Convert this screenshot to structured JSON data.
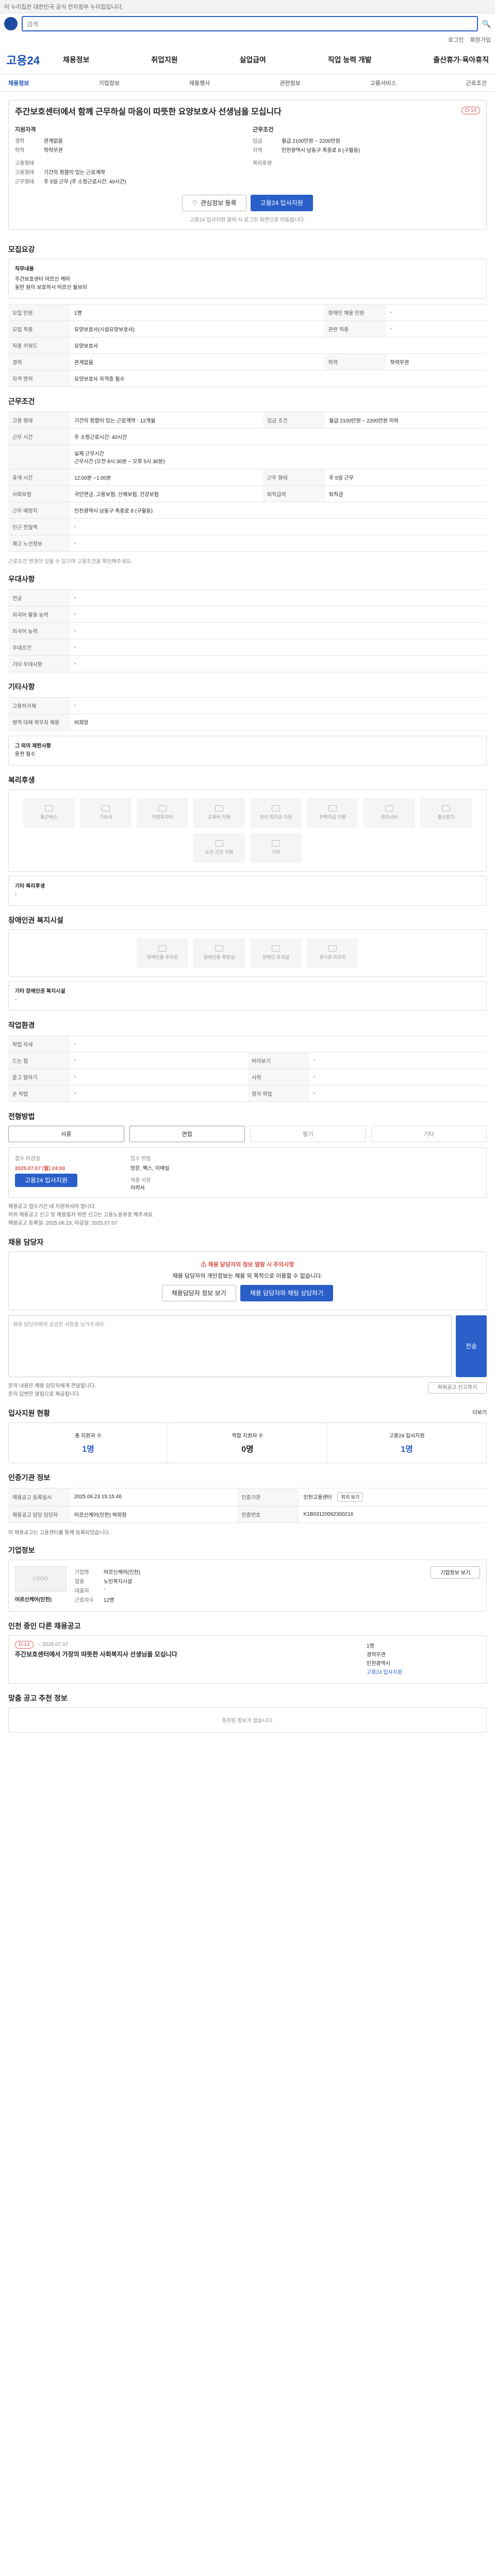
{
  "top_notice": "이 누리집은 대한민국 공식 전자정부 누리집입니다.",
  "search_placeholder": "검색",
  "util_links": [
    "로그인",
    "회원가입"
  ],
  "brand": "고용24",
  "gnb": [
    "채용정보",
    "취업지원",
    "실업급여",
    "직업 능력 개발",
    "출산휴가·육아휴직"
  ],
  "subnav": {
    "active": "채용정보",
    "items": [
      "채용정보",
      "기업정보",
      "채용행사",
      "관련정보",
      "고용서비스",
      "근로조건"
    ]
  },
  "job": {
    "title": "주간보호센터에서 함께 근무하실 마음이 따뜻한 요양보호사 선생님을 모십니다",
    "dday": "D-14",
    "left_head": "지원자격",
    "left_rows": [
      {
        "k": "경력",
        "v": "관계없음"
      },
      {
        "k": "학력",
        "v": "학력무관"
      },
      {
        "k": "고용형태",
        "v": ""
      },
      {
        "k": "고용형태",
        "v": "기간의 정함이 있는 근로계약"
      },
      {
        "k": "근무형태",
        "v": "주 5일 근무 (주 소정근로시간: 40시간)"
      }
    ],
    "right_head": "근무조건",
    "right_rows": [
      {
        "k": "임금",
        "v": "월급 2100만원 ~ 2200만원"
      },
      {
        "k": "지역",
        "v": "인천광역시 남동구 족중로 8 (구월동)"
      },
      {
        "k": "복리후생",
        "v": ""
      }
    ],
    "btn_scrap": "관심정보 등록",
    "btn_apply": "고용24 입사지원",
    "note": "고용24 입사지원 클릭 시 로그인 화면으로 이동됩니다."
  },
  "recruit": {
    "title": "모집요강",
    "desc_label": "직무내용",
    "desc": "주간보호센터 어르신 케어\n동반 원이 보호하시 어르신 돌보미",
    "rows": [
      {
        "k": "모집 인원",
        "v": "1명",
        "k2": "장애인 채용 인원",
        "v2": "-"
      },
      {
        "k": "모집 직종",
        "v": "요양보호사(시설요양보호사)",
        "k2": "관련 직종",
        "v2": "-"
      },
      {
        "k": "직종 키워드",
        "v": "요양보호사",
        "k2": "",
        "v2": ""
      },
      {
        "k": "경력",
        "v": "관계없음",
        "k2": "학력",
        "v2": "학력무관"
      },
      {
        "k": "자격 면허",
        "v": "요양보호사 자격증 필수",
        "k2": "",
        "v2": ""
      }
    ]
  },
  "conditions": {
    "title": "근무조건",
    "rows": [
      {
        "k": "고용 형태",
        "v": "기간의 정함이 있는 근로계약 · 12개월",
        "k2": "임금 조건",
        "v2": "월급 2100만원 ~ 2200만원 이하"
      },
      {
        "k": "근무 시간",
        "v": "주 소정근로시간: 40시간",
        "k2": "",
        "v2": ""
      },
      {
        "k": "",
        "v": "실제 근무시간\n근무시간 (오전 8시 30분 ~ 오후 5시 30분)",
        "k2": "",
        "v2": ""
      },
      {
        "k": "휴게 시간",
        "v": "12:00분 ~1:00분",
        "k2": "근무 형태",
        "v2": "주 5일 근무"
      },
      {
        "k": "사회보험",
        "v": "국민연금, 고용보험, 산재보험, 건강보험",
        "k2": "퇴직급여",
        "v2": "퇴직금"
      },
      {
        "k": "근무 예정지",
        "v": "인천광역시 남동구 족중로 8 (구월동)",
        "k2": "",
        "v2": ""
      },
      {
        "k": "인근 전철역",
        "v": "-",
        "k2": "",
        "v2": ""
      },
      {
        "k": "재고 노선정보",
        "v": "-",
        "k2": "",
        "v2": ""
      }
    ],
    "note": "근로조건 변경이 있을 수 있으며 고용조건을 확인해주세요."
  },
  "preference": {
    "title": "우대사항",
    "rows": [
      {
        "k": "전공",
        "v": "-"
      },
      {
        "k": "외국어 활용 능력",
        "v": "-"
      },
      {
        "k": "외국어 능력",
        "v": "-"
      },
      {
        "k": "우대조건",
        "v": "-"
      },
      {
        "k": "기타 우대사항",
        "v": "-"
      }
    ]
  },
  "etc": {
    "title": "기타사항",
    "rows": [
      {
        "k": "고용허가제",
        "v": "-"
      },
      {
        "k": "병역 대체 복무자 채용",
        "v": "비희망"
      }
    ],
    "extra_label": "그 외의 제한사항",
    "extra_value": "운전 필수"
  },
  "welfare": {
    "title": "복리후생",
    "items": [
      "통근버스",
      "기숙사",
      "차량유지비",
      "교육비 지원",
      "자녀 학자금 지원",
      "주택자금 지원",
      "경조사비",
      "출산휴가",
      "노인 건강 지원",
      "기타"
    ],
    "etc_label": "기타 복리후생",
    "etc_value": "-"
  },
  "disabled": {
    "title": "장애인권 복지시설",
    "items": [
      "장애인용 주차장",
      "장애인용 화장실",
      "장애인 휴게실",
      "경사로 리프트"
    ],
    "etc_label": "기타 장애인권 복지시설",
    "etc_value": "-"
  },
  "env": {
    "title": "작업환경",
    "rows": [
      {
        "k": "작업 자세",
        "v": "-",
        "k2": "",
        "v2": ""
      },
      {
        "k": "드는 힘",
        "v": "-",
        "k2": "바라보기",
        "v2": "-"
      },
      {
        "k": "듣고 말하기",
        "v": "-",
        "k2": "시력",
        "v2": "-"
      },
      {
        "k": "손 작업",
        "v": "-",
        "k2": "청각 작업",
        "v2": "-"
      }
    ]
  },
  "process": {
    "title": "전형방법",
    "steps": [
      "서류",
      "면접",
      "필기",
      "기타"
    ],
    "apply_deadline_label": "접수 마감일",
    "apply_deadline": "2025.07.07 (월) 24:00",
    "apply_method_label": "접수 방법",
    "apply_method": "방문, 팩스, 이메일",
    "docs_label": "제출 서류",
    "docs": "이력서",
    "apply_btn": "고용24 입사지원",
    "notes": [
      "채용공고 접수기간 내 지원하셔야 합니다.",
      "허위 채용공고 신고 및 채용절차 위반 신고는 고용노동부로 해주세요.",
      "채용공고 등록일: 2025.06.23, 마감일: 2025.07.07"
    ]
  },
  "contact": {
    "title": "채용 담당자",
    "alert_title": "채용 담당자의 정보 열람 시 주의사항",
    "alert_body": "채용 담당자의 개인정보는 채용 외 목적으로 이용할 수 없습니다.",
    "btn1": "채용담당자 정보 보기",
    "btn2": "채용 담당자와 채팅 상담하기",
    "qa_placeholder": "채용 담당자에게 궁금한 사항을 남겨주세요.",
    "qa_btn": "전송",
    "notes": [
      "문의 내용은 채용 담당자에게 전달됩니다.",
      "문의 답변은 알림으로 제공됩니다."
    ],
    "report_btn": "허위공고 신고하기"
  },
  "status": {
    "title": "입사지원 현황",
    "more": "더보기",
    "items": [
      {
        "label": "총 지원자 수",
        "value": "1명"
      },
      {
        "label": "적합 지원자 수",
        "value": "0명"
      },
      {
        "label": "고용24 입사지원",
        "value": "1명"
      }
    ]
  },
  "agency": {
    "title": "인증기관 정보",
    "rows": [
      {
        "k": "채용공고 등록일시",
        "v": "2025.06.23 15:15:46",
        "k2": "인증기관",
        "v2": "인천고용센터"
      },
      {
        "k": "채용공고 담당 담당자",
        "v": "어르신케어(인천) 박희정",
        "k2": "인증번호",
        "v2": "K1B03120062300216"
      }
    ],
    "map_btn": "위치 보기",
    "notes": [
      "이 채용공고는 고용센터를 통해 등록되었습니다."
    ]
  },
  "company": {
    "title": "기업정보",
    "logo_text": "LOGO",
    "name": "어르신케어(인천)",
    "rows": [
      {
        "k": "기업명",
        "v": "어르신케어(인천)"
      },
      {
        "k": "업종",
        "v": "노인복지시설"
      },
      {
        "k": "대표자",
        "v": "-"
      },
      {
        "k": "근로자수",
        "v": "12명"
      }
    ],
    "btn": "기업정보 보기"
  },
  "other_jobs": {
    "title": "인천 중인 다른 채용공고",
    "dday": "D-14",
    "date": "~ 2025.07.07",
    "job_title": "주간보호센터에서 가장의 따뜻한 사회복지사 선생님을 모십니다",
    "meta": [
      "1명",
      "경력무관",
      "인천광역시"
    ],
    "tag": "고용24 입사지원"
  },
  "recommend": {
    "title": "맞춤 공고 추천 정보",
    "empty": "추천된 정보가 없습니다."
  }
}
